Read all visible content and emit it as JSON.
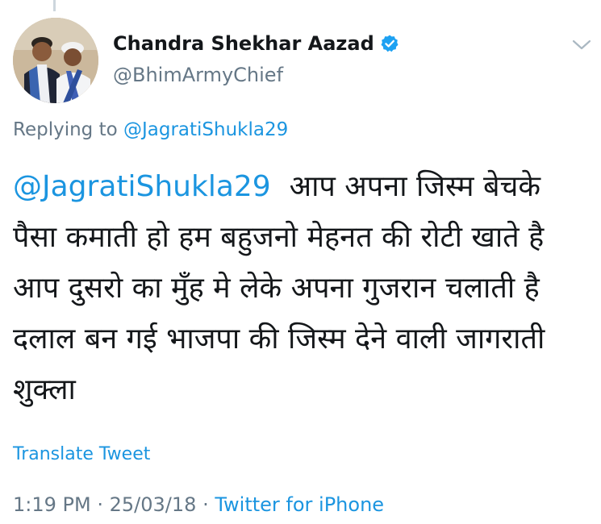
{
  "tweet": {
    "author": {
      "display_name": "Chandra Shekhar Aazad",
      "handle": "@BhimArmyChief",
      "verified": true,
      "avatar_icon": "profile-photo"
    },
    "reply_context": {
      "prefix": "Replying to",
      "mention": "@JagratiShukla29"
    },
    "body": {
      "mention": "@JagratiShukla29",
      "text": "आप अपना जिस्म बेचके पैसा कमाती हो हम बहुजनो मेहनत की रोटी खाते है आप दुसरो का मुँह मे लेके अपना गुजरान चलाती है दलाल बन गई भाजपा की जिस्म देने वाली जागराती शुक्ला"
    },
    "translate_label": "Translate Tweet",
    "time": "1:19 PM",
    "separator": "·",
    "date": "25/03/18",
    "source": "Twitter for iPhone"
  },
  "icons": {
    "menu": "chevron-down-icon",
    "verified": "verified-badge-icon"
  },
  "colors": {
    "link": "#1b95e0",
    "secondary_text": "#657786",
    "primary_text": "#14171a",
    "verified_blue": "#1da1f2"
  }
}
